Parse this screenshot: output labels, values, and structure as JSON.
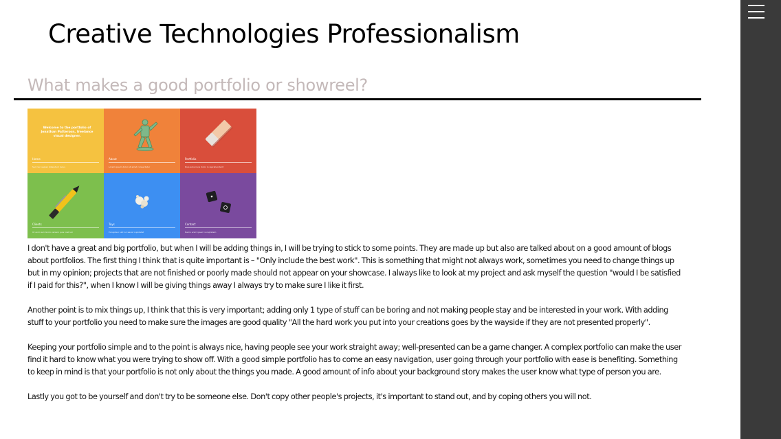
{
  "site": {
    "title": "Creative Technologies Professionalism"
  },
  "post": {
    "title": "What makes a good portfolio or showreel?"
  },
  "image": {
    "tiles": [
      {
        "color": "#f5c240",
        "label": "Home",
        "sub": "Sed non sapien bibendum lacus",
        "welcome": "Welcome to the portfolio of Jonathan Patterson, freelance visual designer."
      },
      {
        "color": "#f0823a",
        "label": "About",
        "sub": "Lorem ipsum dolor sit amet consectetur"
      },
      {
        "color": "#d94e3b",
        "label": "Portfolio",
        "sub": "Duis aute irure dolor in reprehenderit"
      },
      {
        "color": "#7dbf4d",
        "label": "Clients",
        "sub": "Ut enim ad minim veniam quis nostrud"
      },
      {
        "color": "#3d8ff2",
        "label": "Toys",
        "sub": "Excepteur sint occaecat cupidatat"
      },
      {
        "color": "#7a4a9e",
        "label": "Contact",
        "sub": "Nemo enim ipsam voluptatem"
      }
    ]
  },
  "content": {
    "paragraphs": [
      "I don't have a great and big portfolio, but when I will be adding things in, I will be trying to stick to some points. They are made up but also are talked about on a good amount of blogs about portfolios. The first thing I think that is quite important is – \"Only include the best work\". This is something that might not always work, sometimes you need to change things up but in my opinion; projects that are not finished or poorly made should not appear on your showcase. I always like to look at my project and ask myself the question \"would I be satisfied if I paid for this?\", when I know I will be giving things away I always try to make sure I like it first.",
      "Another point is to mix things up, I think that this is very important; adding only 1 type of stuff can be boring and not making people stay and be interested in your work. With adding stuff to your portfolio you need to make sure the images are good quality \"All the hard work you put into your creations goes by the wayside if they are not presented properly\".",
      "Keeping your portfolio simple and to the point is always nice, having people see your work straight away; well-presented can be a game changer. A complex portfolio can make the user find it hard to know what you were trying to show off. With a good simple portfolio has to come an easy navigation, user going through your portfolio with ease is benefiting. Something to keep in mind is that your portfolio is not only about the things you made. A good amount of info about your background story makes the user know what type of person you are.",
      "Lastly you got to be yourself and don't try to be someone else. Don't copy other people's projects, it's important to stand out, and by coping others you will not."
    ]
  },
  "sidebar": {
    "menu_icon": "hamburger-menu-icon",
    "background": "#3a3a3a"
  }
}
